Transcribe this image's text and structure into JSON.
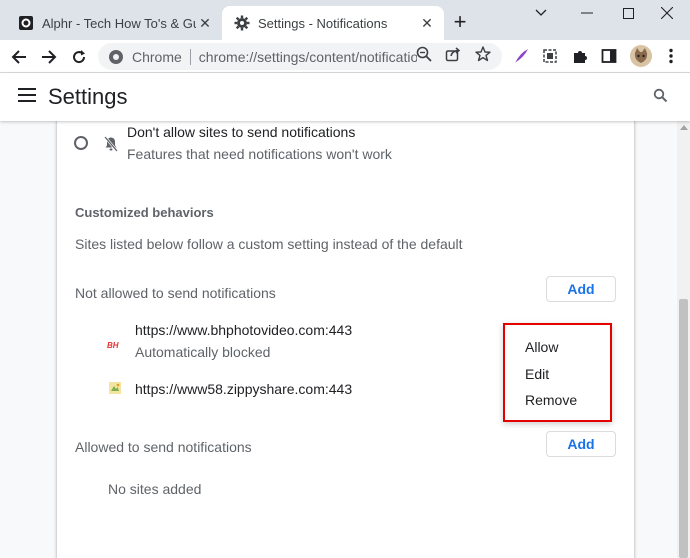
{
  "tabs": [
    {
      "title": "Alphr - Tech How To's & Guides",
      "active": false
    },
    {
      "title": "Settings - Notifications",
      "active": true
    }
  ],
  "window_controls": [
    "chevron-down",
    "minimize",
    "maximize",
    "close"
  ],
  "omnibox": {
    "site_name": "Chrome",
    "url": "chrome://settings/content/notifications"
  },
  "header": {
    "title": "Settings"
  },
  "notifications": {
    "block_option": {
      "label": "Don't allow sites to send notifications",
      "sublabel": "Features that need notifications won't work",
      "selected": false
    },
    "customized": {
      "title": "Customized behaviors",
      "description": "Sites listed below follow a custom setting instead of the default"
    },
    "not_allowed": {
      "title": "Not allowed to send notifications",
      "add_label": "Add",
      "sites": [
        {
          "url": "https://www.bhphotovideo.com:443",
          "status": "Automatically blocked",
          "favicon_text": "BH"
        },
        {
          "url": "https://www58.zippyshare.com:443",
          "status": ""
        }
      ]
    },
    "allowed": {
      "title": "Allowed to send notifications",
      "add_label": "Add",
      "empty_text": "No sites added"
    }
  },
  "context_menu": {
    "items": [
      "Allow",
      "Edit",
      "Remove"
    ],
    "highlight_color": "#e50000"
  },
  "colors": {
    "accent": "#1a73e8",
    "tabstrip": "#dee3ea",
    "page_bg": "#f8f9fa"
  }
}
